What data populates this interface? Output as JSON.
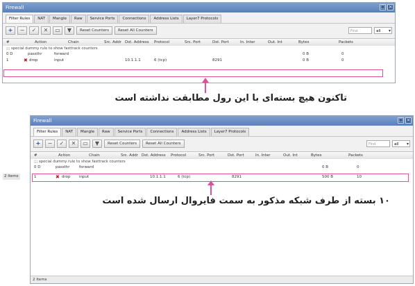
{
  "windows": [
    {
      "title": "Firewall",
      "tabs": [
        "Filter Rules",
        "NAT",
        "Mangle",
        "Raw",
        "Service Ports",
        "Connections",
        "Address Lists",
        "Layer7 Protocols"
      ],
      "toolbar": {
        "reset_counters": "Reset Counters",
        "reset_all_counters": "Reset All Counters",
        "search_placeholder": "Find",
        "chain_filter": "all"
      },
      "columns": [
        "#",
        "Action",
        "Chain",
        "Src. Addr",
        "Dst. Address",
        "Protocol",
        "Src. Port",
        "Dst. Port",
        "In. Inter",
        "Out. Int",
        "Bytes",
        "Packets"
      ],
      "comment": ";;; special dummy rule to show fasttrack counters",
      "dummy_row": {
        "num": "0 D",
        "action": "passthr",
        "chain": "forward",
        "bytes": "0 B",
        "packets": "0"
      },
      "rule_row": {
        "num": "1",
        "action": "drop",
        "chain": "input",
        "dst_address": "10.1.1.1",
        "protocol": "6 (tcp)",
        "dst_port": "8291",
        "bytes": "0 B",
        "packets": "0"
      },
      "status": ""
    },
    {
      "title": "Firewall",
      "tabs": [
        "Filter Rules",
        "NAT",
        "Mangle",
        "Raw",
        "Service Ports",
        "Connections",
        "Address Lists",
        "Layer7 Protocols"
      ],
      "toolbar": {
        "reset_counters": "Reset Counters",
        "reset_all_counters": "Reset All Counters",
        "search_placeholder": "Find",
        "chain_filter": "all"
      },
      "columns": [
        "#",
        "Action",
        "Chain",
        "Src. Addr",
        "Dst. Address",
        "Protocol",
        "Src. Port",
        "Dst. Port",
        "In. Inter",
        "Out. Int",
        "Bytes",
        "Packets"
      ],
      "comment": ";;; special dummy rule to show fasttrack counters",
      "dummy_row": {
        "num": "0 D",
        "action": "passthr",
        "chain": "forward",
        "bytes": "0 B",
        "packets": "0"
      },
      "rule_row": {
        "num": "1",
        "action": "drop",
        "chain": "input",
        "dst_address": "10.1.1.1",
        "protocol": "6 (tcp)",
        "dst_port": "8291",
        "bytes": "500 B",
        "packets": "10"
      },
      "status_left": "2 items",
      "status_bottom": "2 items"
    }
  ],
  "captions": {
    "top": "تاکنون هیچ بسته‌ای با این رول مطابقت نداشته است",
    "bottom": "۱۰ بسته از طرف شبکه مذکور به سمت فایروال ارسال شده است"
  },
  "colors": {
    "highlight": "#e0509a",
    "titlebar": "#5a7fb8",
    "drop_icon": "#cc1010"
  }
}
